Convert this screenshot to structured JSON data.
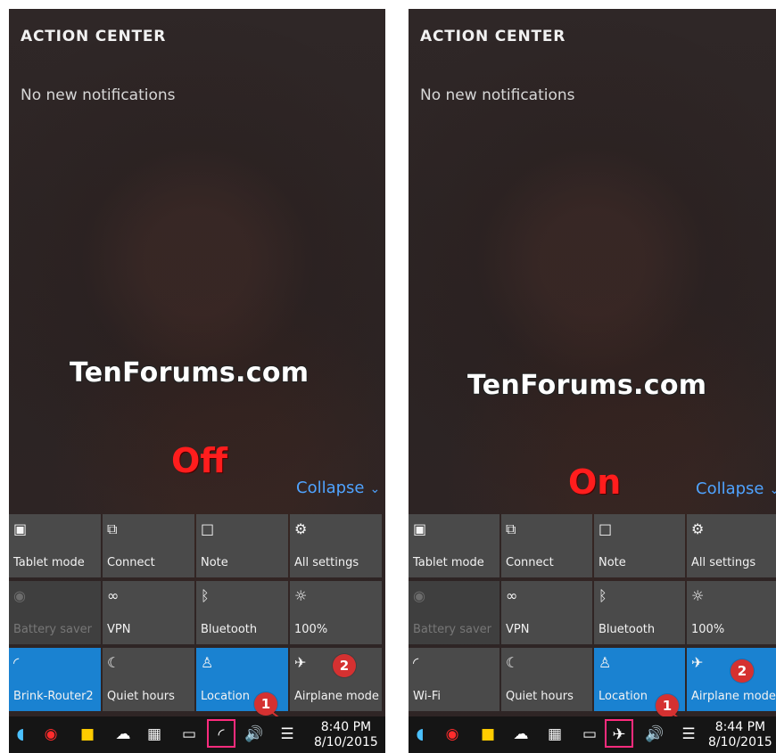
{
  "screens": [
    {
      "title": "ACTION CENTER",
      "no_notifications": "No new notifications",
      "watermark": "TenForums.com",
      "state": "Off",
      "collapse": "Collapse",
      "tiles": [
        {
          "label": "Tablet mode",
          "icon": "tablet-mode-icon"
        },
        {
          "label": "Connect",
          "icon": "connect-icon"
        },
        {
          "label": "Note",
          "icon": "note-icon"
        },
        {
          "label": "All settings",
          "icon": "gear-icon"
        },
        {
          "label": "Battery saver",
          "icon": "battery-saver-icon"
        },
        {
          "label": "VPN",
          "icon": "vpn-icon"
        },
        {
          "label": "Bluetooth",
          "icon": "bluetooth-icon"
        },
        {
          "label": "100%",
          "icon": "brightness-icon"
        },
        {
          "label": "Brink-Router2",
          "icon": "wifi-icon"
        },
        {
          "label": "Quiet hours",
          "icon": "moon-icon"
        },
        {
          "label": "Location",
          "icon": "location-icon"
        },
        {
          "label": "Airplane mode",
          "icon": "airplane-icon"
        }
      ],
      "time": "8:40 PM",
      "date": "8/10/2015",
      "badge_1": "1",
      "badge_2": "2"
    },
    {
      "title": "ACTION CENTER",
      "no_notifications": "No new notifications",
      "watermark": "TenForums.com",
      "state": "On",
      "collapse": "Collapse",
      "tiles": [
        {
          "label": "Tablet mode",
          "icon": "tablet-mode-icon"
        },
        {
          "label": "Connect",
          "icon": "connect-icon"
        },
        {
          "label": "Note",
          "icon": "note-icon"
        },
        {
          "label": "All settings",
          "icon": "gear-icon"
        },
        {
          "label": "Battery saver",
          "icon": "battery-saver-icon"
        },
        {
          "label": "VPN",
          "icon": "vpn-icon"
        },
        {
          "label": "Bluetooth",
          "icon": "bluetooth-icon"
        },
        {
          "label": "100%",
          "icon": "brightness-icon"
        },
        {
          "label": "Wi-Fi",
          "icon": "wifi-icon"
        },
        {
          "label": "Quiet hours",
          "icon": "moon-icon"
        },
        {
          "label": "Location",
          "icon": "location-icon"
        },
        {
          "label": "Airplane mode",
          "icon": "airplane-icon"
        }
      ],
      "time": "8:44 PM",
      "date": "8/10/2015",
      "badge_1": "1",
      "badge_2": "2"
    }
  ],
  "colors": {
    "accent_blue": "#1a82d1",
    "tile_gray": "#4a4a4a",
    "collapse_blue": "#4fa3ff",
    "badge_red": "#d53131",
    "state_red": "#ff1d1d",
    "taskbar_highlight": "#ff2b7d"
  }
}
